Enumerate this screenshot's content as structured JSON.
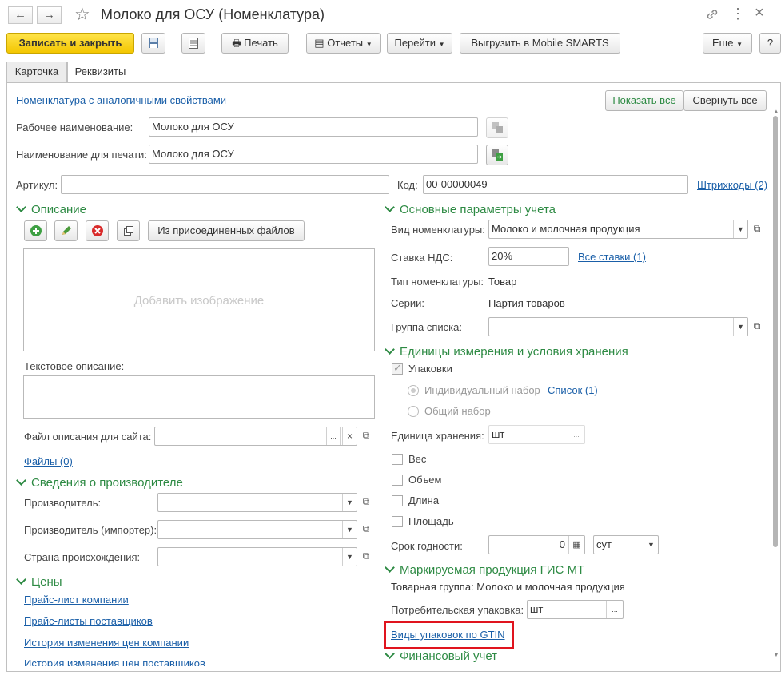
{
  "window": {
    "title": "Молоко для ОСУ (Номенклатура)",
    "back": "←",
    "forward": "→",
    "star": "☆",
    "link_icon": "🔗",
    "menu_icon": "⋮",
    "close_icon": "×"
  },
  "toolbar": {
    "save_close": "Записать и закрыть",
    "print": "Печать",
    "reports": "Отчеты",
    "goto": "Перейти",
    "export": "Выгрузить в Mobile SMARTS",
    "more": "Еще",
    "help": "?"
  },
  "tabs": [
    {
      "label": "Карточка"
    },
    {
      "label": "Реквизиты"
    }
  ],
  "top": {
    "analog_link": "Номенклатура с аналогичными свойствами",
    "show_all": "Показать все",
    "collapse_all": "Свернуть все",
    "work_name_label": "Рабочее наименование:",
    "work_name": "Молоко для ОСУ",
    "print_name_label": "Наименование для печати:",
    "print_name": "Молоко для ОСУ",
    "article_label": "Артикул:",
    "article": "",
    "code_label": "Код:",
    "code": "00-00000049",
    "barcodes_link": "Штрихкоды (2)"
  },
  "description": {
    "header": "Описание",
    "attached_files": "Из присоединенных файлов",
    "add_image": "Добавить изображение",
    "text_desc_label": "Текстовое описание:",
    "site_file_label": "Файл описания для сайта:",
    "site_file": "",
    "files_link": "Файлы (0)"
  },
  "manufacturer": {
    "header": "Сведения о производителе",
    "producer_label": "Производитель:",
    "importer_label": "Производитель (импортер):",
    "country_label": "Страна происхождения:"
  },
  "prices": {
    "header": "Цены",
    "links": [
      "Прайс-лист компании",
      "Прайс-листы поставщиков",
      "История изменения цен компании",
      "История изменения цен поставщиков"
    ]
  },
  "accounting": {
    "header": "Основные параметры учета",
    "kind_label": "Вид номенклатуры:",
    "kind": "Молоко и молочная продукция",
    "vat_label": "Ставка НДС:",
    "vat": "20%",
    "all_rates": "Все ставки (1)",
    "type_label": "Тип номенклатуры:",
    "type": "Товар",
    "series_label": "Серии:",
    "series": "Партия товаров",
    "group_label": "Группа списка:",
    "group": ""
  },
  "units": {
    "header": "Единицы измерения и условия хранения",
    "packages": "Упаковки",
    "individual": "Индивидуальный набор",
    "list_link": "Список (1)",
    "common": "Общий набор",
    "storage_unit_label": "Единица хранения:",
    "storage_unit": "шт",
    "weight": "Вес",
    "volume": "Объем",
    "length": "Длина",
    "area": "Площадь",
    "shelf_life_label": "Срок годности:",
    "shelf_life": "0",
    "shelf_unit": "сут"
  },
  "marking": {
    "header": "Маркируемая продукция ГИС МТ",
    "product_group": "Товарная группа: Молоко и молочная продукция",
    "consumer_pack_label": "Потребительская упаковка:",
    "consumer_pack": "шт",
    "gtin_link": "Виды упаковок по GTIN"
  },
  "finance": {
    "header": "Финансовый учет"
  },
  "colors": {
    "accent_green": "#2d8a43",
    "link": "#1a5fa8",
    "primary_button": "#f3c600",
    "highlight": "#e0141e"
  }
}
